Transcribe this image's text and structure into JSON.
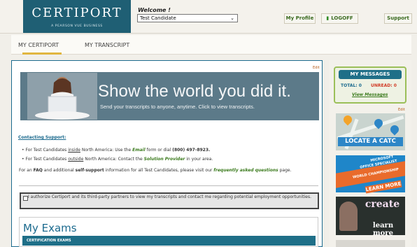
{
  "header": {
    "logo_text": "CERTIPORT",
    "logo_sub": "A PEARSON VUE BUSINESS",
    "welcome": "Welcome !",
    "candidate_select": "Test Candidate",
    "my_profile": "My Profile",
    "logoff": "LOGOFF",
    "support": "Support",
    "colors": {
      "brand": "#1f5f74",
      "accent": "#e1b63f",
      "link": "#3a7a1c"
    }
  },
  "tabs": [
    {
      "label": "MY CERTIPORT",
      "active": true
    },
    {
      "label": "MY TRANSCRIPT",
      "active": false
    }
  ],
  "main": {
    "edit": "Edit",
    "banner": {
      "title": "Show the world you did it.",
      "subtitle": "Send your transcripts to anyone, anytime. Click to view transcripts."
    },
    "support_heading": "Contacting Support:",
    "inside_1": "For Test Candidates ",
    "inside_2": "inside",
    "inside_3": " North America: Use the ",
    "inside_4": "Email",
    "inside_5": " form or dial ",
    "inside_6": "(800) 497-8923.",
    "outside_1": "For Test Candidates ",
    "outside_2": "outside",
    "outside_3": " North America: Contact the ",
    "outside_4": "Solution Provider",
    "outside_5": " in your area.",
    "faq_1": "For an ",
    "faq_2": "FAQ",
    "faq_3": " and additional ",
    "faq_4": "self-support",
    "faq_5": " information for all Test Candidates, please visit our ",
    "faq_6": "frequently asked questions",
    "faq_7": " page.",
    "consent_text": "I authorize Certiport and its third-party partners to view my transcripts and contact me regarding potential employment opportunities.",
    "exams_title": "My Exams",
    "exams_header": "CERTIFICATION EXAMS"
  },
  "side": {
    "messages_title": "MY MESSAGES",
    "total_label": "TOTAL: 0",
    "unread_label": "UNREAD: 0",
    "view_messages": "View Messages",
    "edit": "Edit",
    "promo1": "LOCATE A CATC",
    "promo2_a": "MICROSOFT",
    "promo2_b": "OFFICE SPECIALIST",
    "promo2_c": "WORLD CHAMPIONSHIP",
    "promo2_d": "LEARN MORE",
    "promo3_a": "create",
    "promo3_b": "learn more"
  }
}
